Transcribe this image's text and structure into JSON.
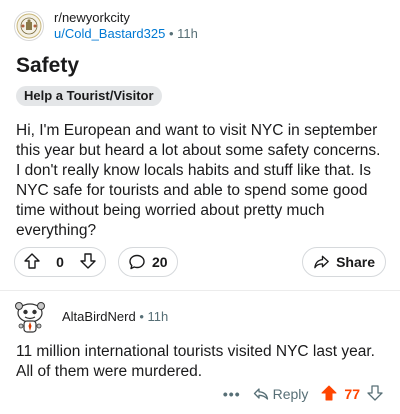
{
  "post": {
    "subreddit": "r/newyorkcity",
    "author": "u/Cold_Bastard325",
    "separator": "•",
    "age": "11h",
    "title": "Safety",
    "flair": "Help a Tourist/Visitor",
    "body": "Hi, I'm European and want to visit NYC in september this year but heard a lot about some safety concerns. I don't really know locals habits and stuff like that. Is NYC safe for tourists and able to spend some good time without being worried about pretty much everything?",
    "score": "0",
    "comments_count": "20",
    "share_label": "Share"
  },
  "comment": {
    "author": "AltaBirdNerd",
    "separator": "•",
    "age": "11h",
    "text": "11 million international tourists visited NYC last year. All of them were murdered.",
    "more_label": "•••",
    "reply_label": "Reply",
    "score": "77",
    "upvoted": true
  },
  "colors": {
    "accent_upvote": "#ff4500",
    "link_blue": "#0079d3",
    "meta_gray": "#576f76",
    "flair_bg": "#e4e6e8"
  },
  "icons": {
    "upvote": "arrow-up-outline-icon",
    "downvote": "arrow-down-outline-icon",
    "comments": "speech-bubble-icon",
    "share": "share-arrow-icon",
    "reply": "reply-arrow-icon",
    "upvoted": "arrow-up-filled-icon"
  }
}
